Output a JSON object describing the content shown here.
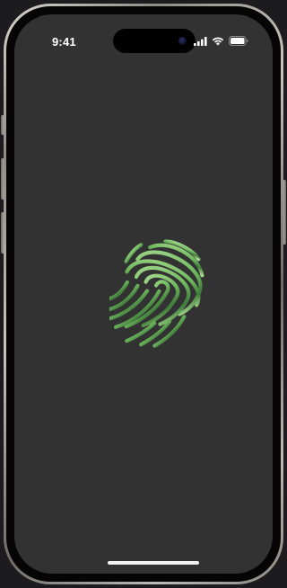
{
  "device": {
    "model": "iPhone",
    "screen_background": "#323232",
    "frame_color": "titanium"
  },
  "status_bar": {
    "time": "9:41",
    "icons": [
      "cellular-signal-icon",
      "wifi-icon",
      "battery-icon"
    ]
  },
  "main": {
    "icon": "fingerprint-icon",
    "colors": {
      "light_green": "#a7d98f",
      "mid_green": "#6fb85f",
      "dark_green": "#3f7a3a"
    }
  },
  "home_indicator": {
    "color": "#f2f2f2"
  }
}
